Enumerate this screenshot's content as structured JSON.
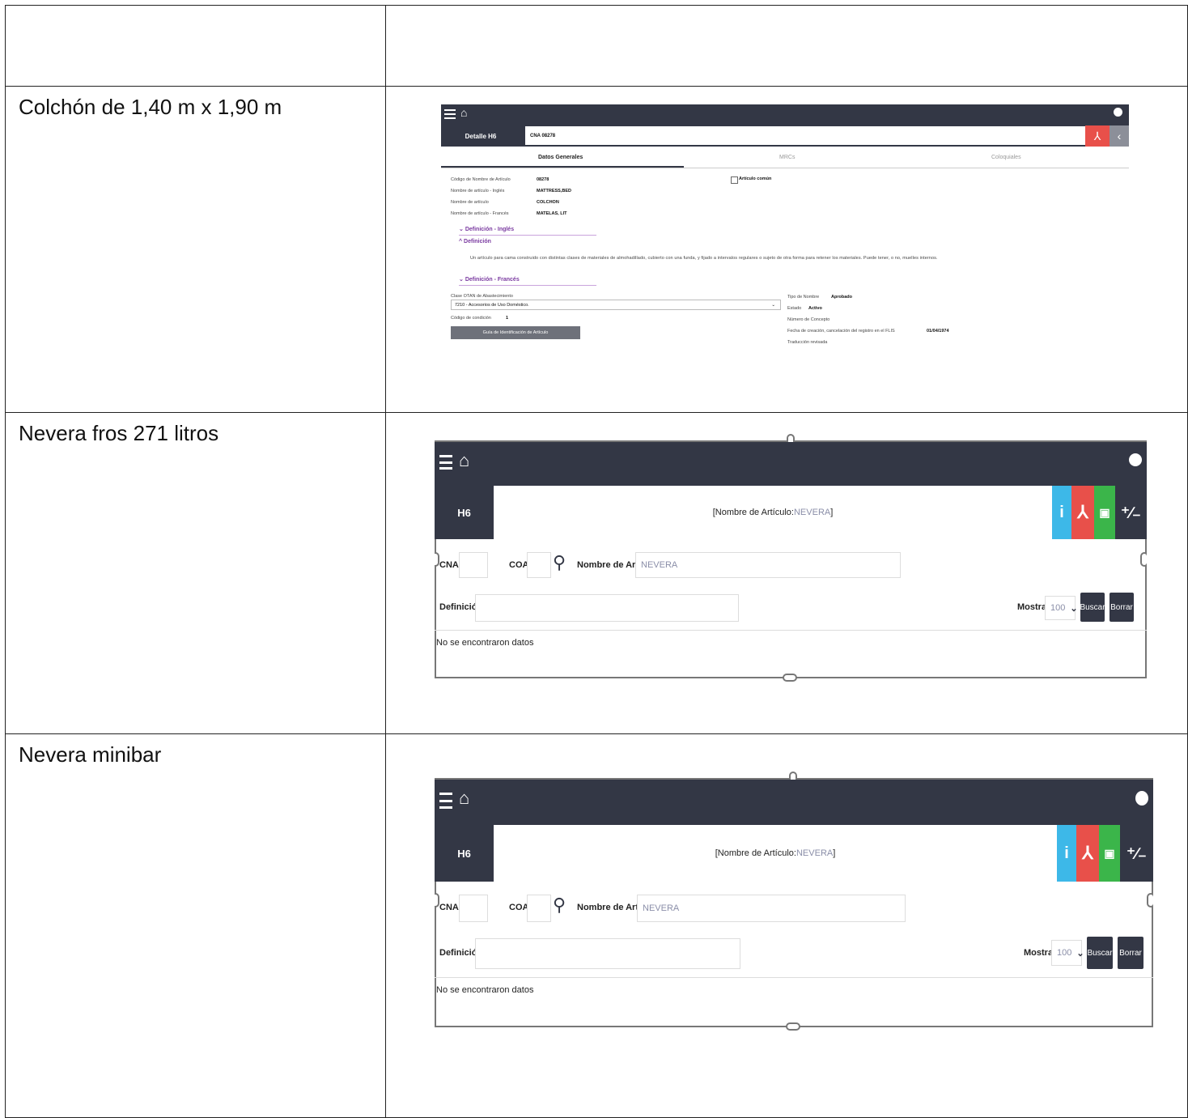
{
  "rows": [
    {
      "label": ""
    },
    {
      "label": "Colchón de 1,40 m x 1,90 m"
    },
    {
      "label": "Nevera fros 271 litros"
    },
    {
      "label": "Nevera minibar"
    }
  ],
  "shot1": {
    "detail_label": "Detalle H6",
    "cna_value": "CNA 08278",
    "tabs": [
      "Datos Generales",
      "MRCs",
      "Coloquiales"
    ],
    "fields": [
      {
        "label": "Código de Nombre de Artículo",
        "value": "08278"
      },
      {
        "label": "Nombre de artículo - Inglés",
        "value": "MATTRESS,BED"
      },
      {
        "label": "Nombre de artículo",
        "value": "COLCHON"
      },
      {
        "label": "Nombre de artículo - Francés",
        "value": "MATELAS, LIT"
      }
    ],
    "common_checkbox": "Artículo común",
    "sections": {
      "def_en": "Definición - Inglés",
      "def": "Definición",
      "def_fr": "Definición - Francés"
    },
    "definition_text": "Un artículo para cama construido con distintas clases de materiales de almohadillado, cubierto con una funda, y fijado a intervalos regulares o sujeto de otra forma para retener los materiales. Puede tener, o no, muelles internos.",
    "supply_class_label": "Clase OTAN de Abastecimiento",
    "supply_class_value": "7210 - Accesorios de Uso Doméstico.",
    "condition_label": "Código de condición",
    "condition_value": "1",
    "guide_button": "Guía de Identificación de Artículo",
    "name_type_label": "Tipo de Nombre",
    "name_type_value": "Aprobado",
    "state_label": "Estado",
    "state_value": "Activo",
    "concept_label": "Número de Concepto",
    "creation_label": "Fecha de creación, cancelación del registro en el FLIS",
    "creation_value": "01/04/1974",
    "translation_label": "Traducción revisada"
  },
  "shot2": {
    "h6_label": "H6",
    "title_prefix": "[Nombre de Artículo: ",
    "title_value": "NEVERA",
    "title_suffix": "]",
    "cna_label": "CNA",
    "coa_label": "COA",
    "name_label": "Nombre de Artículo",
    "name_value": "NEVERA",
    "definition_label": "Definición",
    "show_label": "Mostrar",
    "show_value": "100",
    "search_button": "Buscar",
    "clear_button": "Borrar",
    "no_data": "No se encontraron datos"
  },
  "shot3": {
    "h6_label": "H6",
    "title_prefix": "[Nombre de Artículo: ",
    "title_value": "NEVERA",
    "title_suffix": "]",
    "cna_label": "CNA",
    "coa_label": "COA",
    "name_label": "Nombre de Artículo",
    "name_value": "NEVERA",
    "definition_label": "Definición",
    "show_label": "Mostrar",
    "show_value": "100",
    "search_button": "Buscar",
    "clear_button": "Borrar",
    "no_data": "No se encontraron datos"
  },
  "colors": {
    "navbar": "#333745",
    "info": "#3db8e8",
    "pdf": "#e8504a",
    "excel": "#3bb54a",
    "section": "#7a3aa0"
  },
  "icons": [
    "menu-icon",
    "home-icon",
    "user-icon",
    "pdf-icon",
    "back-icon",
    "info-icon",
    "excel-icon",
    "plus-minus-icon",
    "search-icon",
    "chevron-down-icon"
  ]
}
